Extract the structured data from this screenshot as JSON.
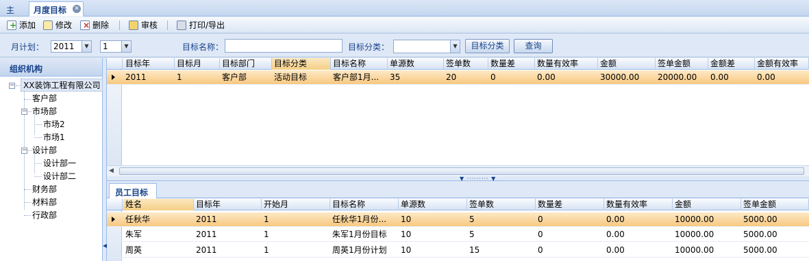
{
  "tabs": [
    {
      "label": "主页"
    },
    {
      "label": "月度目标"
    }
  ],
  "toolbar": {
    "add": "添加",
    "edit": "修改",
    "delete": "删除",
    "audit": "审核",
    "print": "打印/导出"
  },
  "filters": {
    "month_plan_label": "月计划：",
    "year_value": "2011",
    "month_value": "1",
    "target_name_label": "目标名称：",
    "target_name_value": "",
    "category_label": "目标分类：",
    "category_value": "",
    "category_button": "目标分类",
    "query_button": "查询"
  },
  "sidebar": {
    "title": "组织机构",
    "tree": [
      {
        "label": "XX装饰工程有限公司"
      },
      {
        "label": "客户部"
      },
      {
        "label": "市场部"
      },
      {
        "label": "市场2"
      },
      {
        "label": "市场1"
      },
      {
        "label": "设计部"
      },
      {
        "label": "设计部一"
      },
      {
        "label": "设计部二"
      },
      {
        "label": "财务部"
      },
      {
        "label": "材料部"
      },
      {
        "label": "行政部"
      }
    ]
  },
  "dept_grid": {
    "columns": [
      "目标年",
      "目标月",
      "目标部门",
      "目标分类",
      "目标名称",
      "单源数",
      "签单数",
      "数量差",
      "数量有效率",
      "金额",
      "签单金额",
      "金额差",
      "金额有效率"
    ],
    "rows": [
      [
        "2011",
        "1",
        "客户部",
        "活动目标",
        "客户部1月...",
        "35",
        "20",
        "0",
        "0.00",
        "30000.00",
        "20000.00",
        "0.00",
        "0.00"
      ]
    ]
  },
  "employee_tab": "员工目标",
  "emp_grid": {
    "columns": [
      "姓名",
      "目标年",
      "开始月",
      "目标名称",
      "单源数",
      "签单数",
      "数量差",
      "数量有效率",
      "金额",
      "签单金额"
    ],
    "rows": [
      [
        "任秋华",
        "2011",
        "1",
        "任秋华1月份...",
        "10",
        "5",
        "0",
        "0.00",
        "10000.00",
        "5000.00"
      ],
      [
        "朱军",
        "2011",
        "1",
        "朱军1月份目标",
        "10",
        "5",
        "0",
        "0.00",
        "10000.00",
        "5000.00"
      ],
      [
        "周英",
        "2011",
        "1",
        "周英1月份计划",
        "10",
        "15",
        "0",
        "0.00",
        "10000.00",
        "5000.00"
      ]
    ]
  }
}
